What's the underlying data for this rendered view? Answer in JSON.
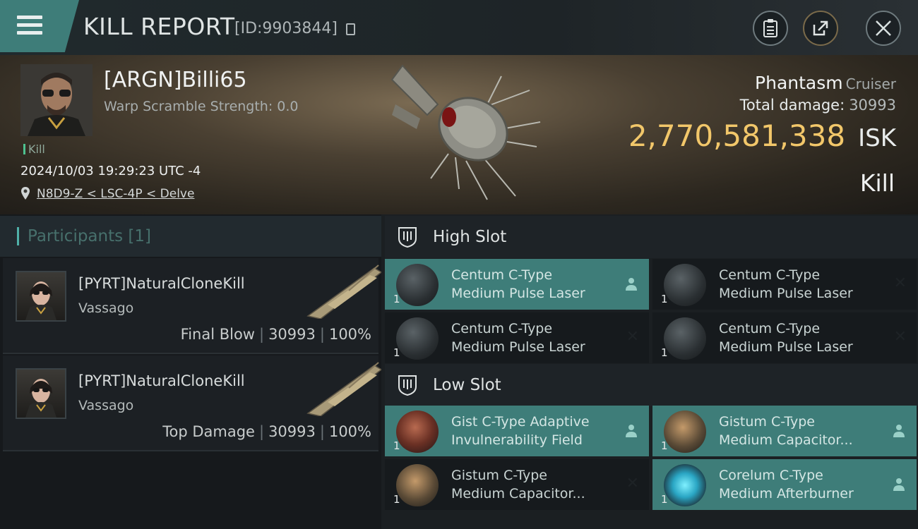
{
  "header": {
    "title": "KILL REPORT",
    "report_id": "[ID:9903844]"
  },
  "victim": {
    "name": "[ARGN]Billi65",
    "warp_scramble": "Warp Scramble Strength: 0.0",
    "status_tag": "Kill",
    "datetime": "2024/10/03 19:29:23 UTC -4",
    "location": "N8D9-Z < LSC-4P < Delve",
    "ship_name": "Phantasm",
    "ship_class": "Cruiser",
    "total_damage_label": "Total damage:",
    "total_damage": "30993",
    "isk_value": "2,770,581,338",
    "isk_unit": "ISK",
    "result": "Kill"
  },
  "participants": {
    "header": "Participants [1]",
    "items": [
      {
        "name": "[PYRT]NaturalCloneKill",
        "ship": "Vassago",
        "role": "Final Blow",
        "damage": "30993",
        "percent": "100%"
      },
      {
        "name": "[PYRT]NaturalCloneKill",
        "ship": "Vassago",
        "role": "Top Damage",
        "damage": "30993",
        "percent": "100%"
      }
    ]
  },
  "slots": {
    "high": {
      "label": "High Slot",
      "modules": [
        {
          "line1": "Centum C-Type",
          "line2": "Medium Pulse Laser",
          "qty": "1",
          "state": "destroyed-dropped"
        },
        {
          "line1": "Centum C-Type",
          "line2": "Medium Pulse Laser",
          "qty": "1",
          "state": "destroyed"
        },
        {
          "line1": "Centum C-Type",
          "line2": "Medium Pulse Laser",
          "qty": "1",
          "state": "destroyed"
        },
        {
          "line1": "Centum C-Type",
          "line2": "Medium Pulse Laser",
          "qty": "1",
          "state": "destroyed"
        }
      ]
    },
    "low": {
      "label": "Low Slot",
      "modules": [
        {
          "line1": "Gist C-Type Adaptive",
          "line2": "Invulnerability Field",
          "qty": "1",
          "state": "dropped"
        },
        {
          "line1": "Gistum C-Type",
          "line2": "Medium Capacitor...",
          "qty": "1",
          "state": "dropped"
        },
        {
          "line1": "Gistum C-Type",
          "line2": "Medium Capacitor...",
          "qty": "1",
          "state": "destroyed"
        },
        {
          "line1": "Corelum C-Type",
          "line2": "Medium Afterburner",
          "qty": "1",
          "state": "dropped"
        }
      ]
    }
  },
  "colors": {
    "accent": "#3e7d79",
    "isk": "#f2c76a"
  },
  "icons": [
    "menu-icon",
    "copy-icon",
    "clipboard-icon",
    "share-icon",
    "close-icon",
    "location-pin-icon",
    "slot-shield-icon",
    "person-icon",
    "x-icon"
  ]
}
